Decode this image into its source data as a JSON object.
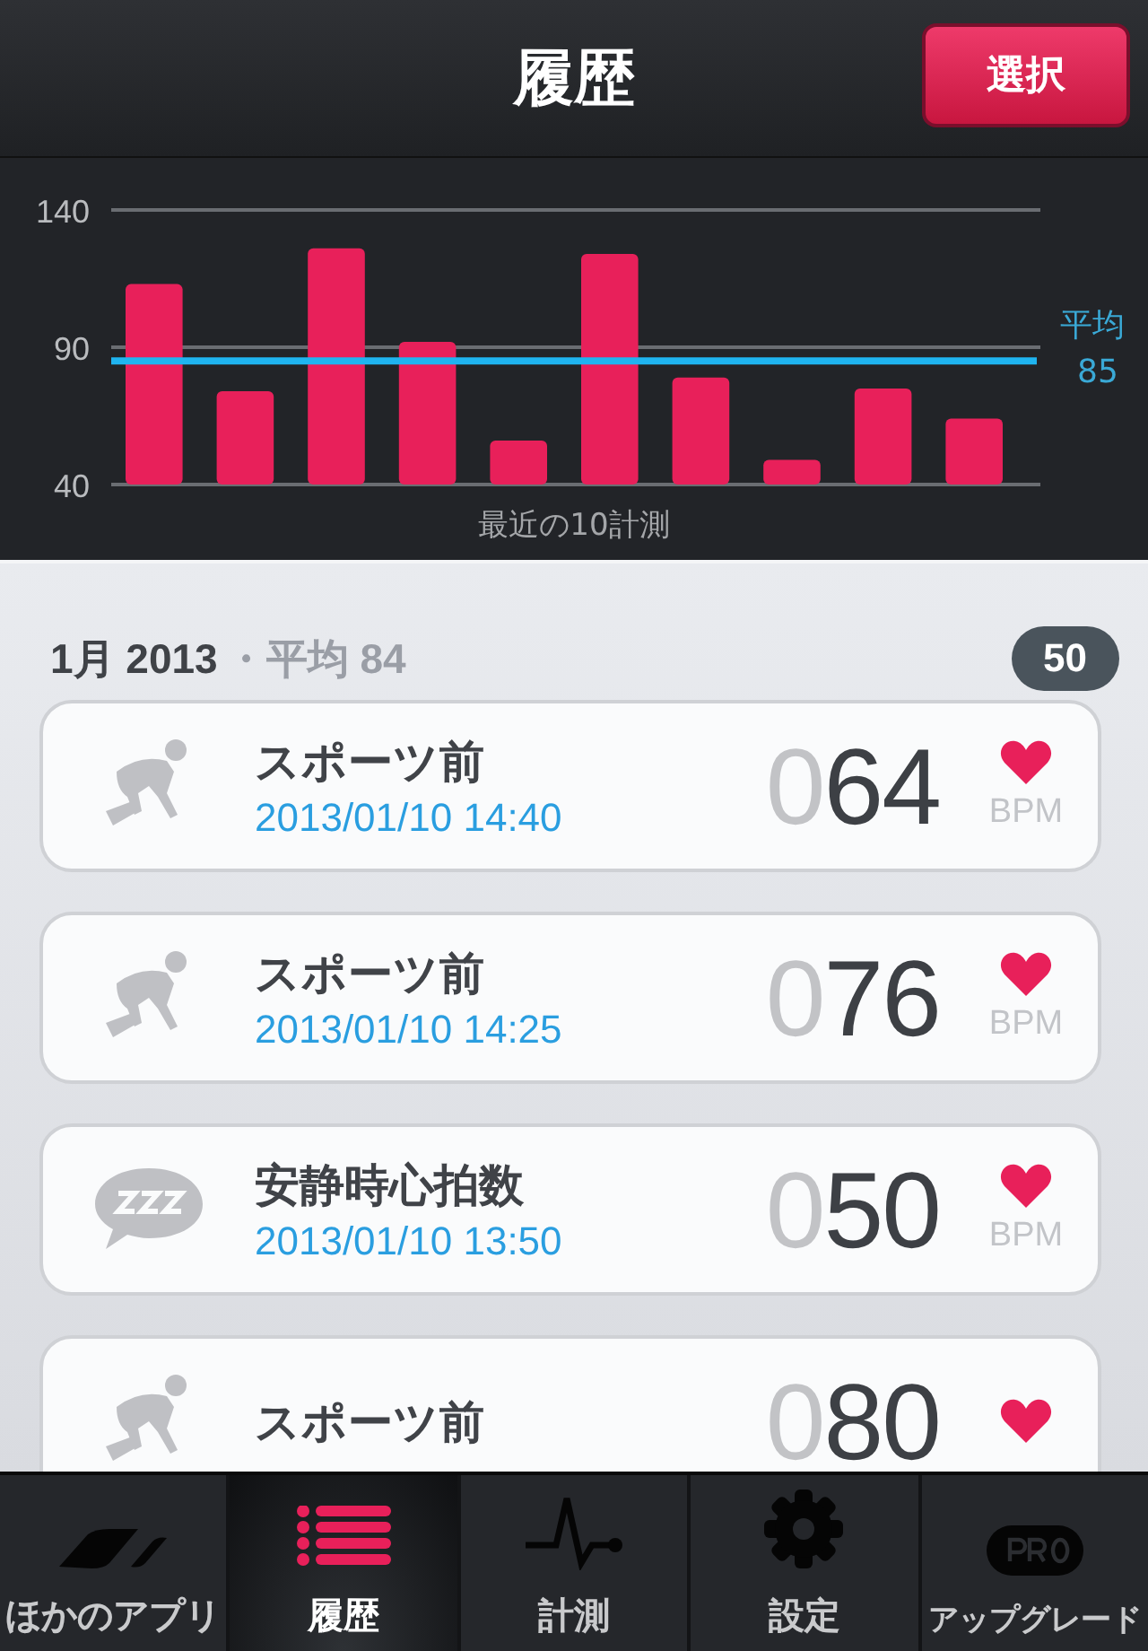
{
  "header": {
    "title": "履歴",
    "select_button": "選択"
  },
  "chart": {
    "chart_data": {
      "type": "bar",
      "xlabel": "最近の10計測",
      "series": [
        {
          "color": "#e8205a",
          "values": [
            113,
            74,
            126,
            92,
            56,
            124,
            79,
            49,
            75,
            64
          ]
        }
      ],
      "ylim": [
        40,
        140
      ],
      "yticks": [
        40,
        90,
        140
      ],
      "ref_lines": [
        {
          "axis": "y",
          "value": 85,
          "label": "平均 85",
          "color": "#1fb4f0"
        }
      ]
    }
  },
  "section": {
    "month": "1月 2013",
    "average": "・平均 84",
    "count": "50"
  },
  "records": [
    {
      "kind": "sport",
      "title": "スポーツ前",
      "date": "2013/01/10 14:40",
      "lead": "0",
      "value": "64",
      "unit": "BPM"
    },
    {
      "kind": "sport",
      "title": "スポーツ前",
      "date": "2013/01/10 14:25",
      "lead": "0",
      "value": "76",
      "unit": "BPM"
    },
    {
      "kind": "rest",
      "title": "安静時心拍数",
      "date": "2013/01/10 13:50",
      "lead": "0",
      "value": "50",
      "unit": "BPM"
    },
    {
      "kind": "sport",
      "title": "スポーツ前",
      "lead": "0",
      "value": "80"
    }
  ],
  "tabs": [
    {
      "kind": "apps",
      "label": "ほかのアプリ",
      "selected": false
    },
    {
      "kind": "history",
      "label": "履歴",
      "selected": true
    },
    {
      "kind": "measure",
      "label": "計測",
      "selected": false
    },
    {
      "kind": "settings",
      "label": "設定",
      "selected": false
    },
    {
      "kind": "pro",
      "label": "アップグレード",
      "selected": false
    }
  ]
}
